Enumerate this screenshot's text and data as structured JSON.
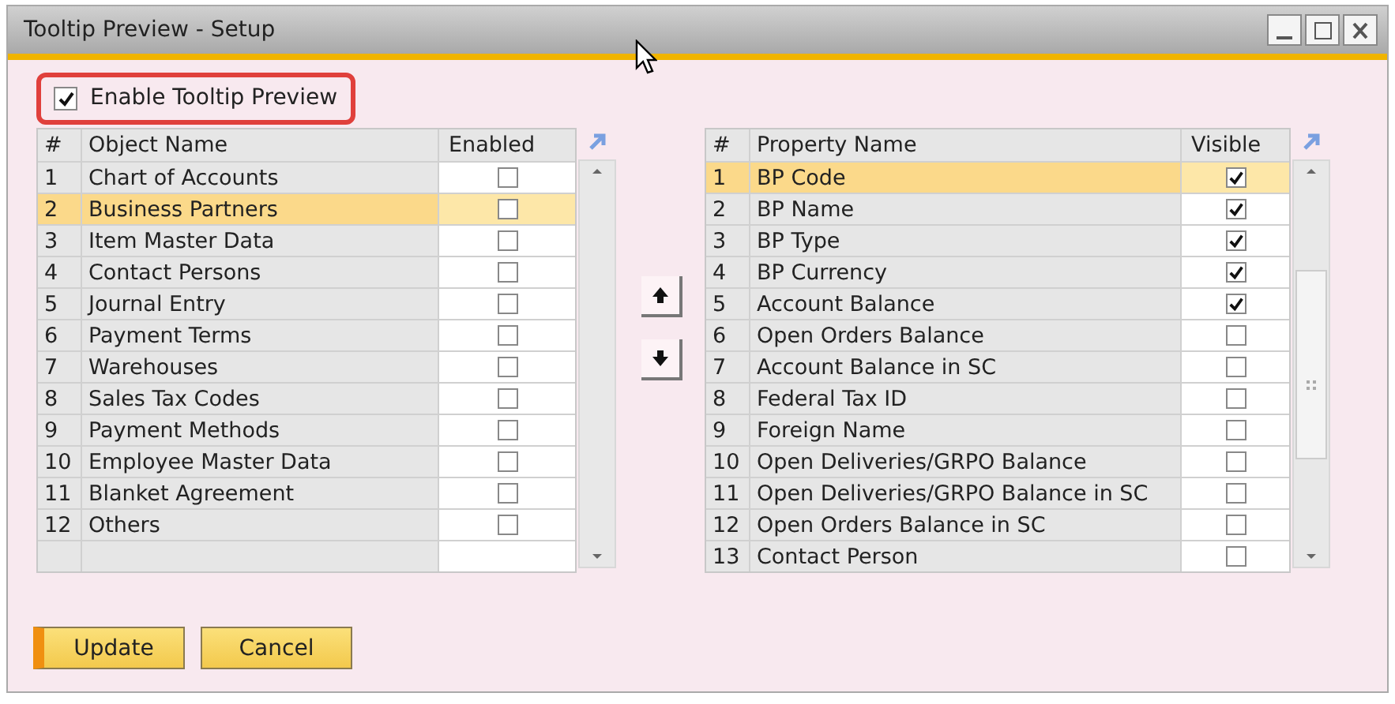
{
  "window": {
    "title": "Tooltip Preview - Setup"
  },
  "enable_checkbox": {
    "label": "Enable Tooltip Preview",
    "checked": true
  },
  "objects_table": {
    "columns": [
      "#",
      "Object Name",
      "Enabled"
    ],
    "rows": [
      {
        "index": "1",
        "name": "Chart of Accounts",
        "enabled": false,
        "selected": false
      },
      {
        "index": "2",
        "name": "Business Partners",
        "enabled": false,
        "selected": true
      },
      {
        "index": "3",
        "name": "Item Master Data",
        "enabled": false,
        "selected": false
      },
      {
        "index": "4",
        "name": "Contact Persons",
        "enabled": false,
        "selected": false
      },
      {
        "index": "5",
        "name": "Journal Entry",
        "enabled": false,
        "selected": false
      },
      {
        "index": "6",
        "name": "Payment Terms",
        "enabled": false,
        "selected": false
      },
      {
        "index": "7",
        "name": "Warehouses",
        "enabled": false,
        "selected": false
      },
      {
        "index": "8",
        "name": "Sales Tax Codes",
        "enabled": false,
        "selected": false
      },
      {
        "index": "9",
        "name": "Payment Methods",
        "enabled": false,
        "selected": false
      },
      {
        "index": "10",
        "name": "Employee Master Data",
        "enabled": false,
        "selected": false
      },
      {
        "index": "11",
        "name": "Blanket Agreement",
        "enabled": false,
        "selected": false
      },
      {
        "index": "12",
        "name": "Others",
        "enabled": false,
        "selected": false
      }
    ]
  },
  "properties_table": {
    "columns": [
      "#",
      "Property Name",
      "Visible"
    ],
    "rows": [
      {
        "index": "1",
        "name": "BP Code",
        "visible": true,
        "selected": true
      },
      {
        "index": "2",
        "name": "BP Name",
        "visible": true,
        "selected": false
      },
      {
        "index": "3",
        "name": "BP Type",
        "visible": true,
        "selected": false
      },
      {
        "index": "4",
        "name": "BP Currency",
        "visible": true,
        "selected": false
      },
      {
        "index": "5",
        "name": "Account Balance",
        "visible": true,
        "selected": false
      },
      {
        "index": "6",
        "name": "Open Orders Balance",
        "visible": false,
        "selected": false
      },
      {
        "index": "7",
        "name": "Account Balance in SC",
        "visible": false,
        "selected": false
      },
      {
        "index": "8",
        "name": "Federal Tax ID",
        "visible": false,
        "selected": false
      },
      {
        "index": "9",
        "name": "Foreign Name",
        "visible": false,
        "selected": false
      },
      {
        "index": "10",
        "name": "Open Deliveries/GRPO Balance",
        "visible": false,
        "selected": false
      },
      {
        "index": "11",
        "name": "Open Deliveries/GRPO Balance in SC",
        "visible": false,
        "selected": false
      },
      {
        "index": "12",
        "name": "Open Orders Balance in SC",
        "visible": false,
        "selected": false
      },
      {
        "index": "13",
        "name": "Contact Person",
        "visible": false,
        "selected": false
      }
    ]
  },
  "buttons": [
    {
      "label": "Update",
      "default": true
    },
    {
      "label": "Cancel",
      "default": false
    }
  ]
}
